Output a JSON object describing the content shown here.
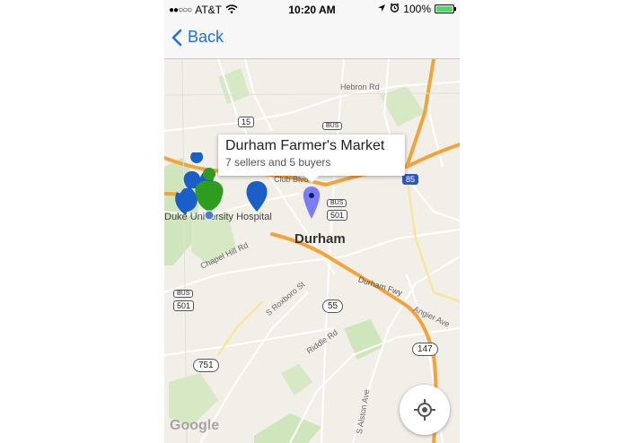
{
  "status_bar": {
    "carrier": "AT&T",
    "time": "10:20 AM",
    "battery": "100%"
  },
  "nav": {
    "back_label": "Back"
  },
  "map": {
    "labels": {
      "durham": "Durham",
      "hospital": "Duke University Hospital",
      "club_blvd": "Club Blvd",
      "hebron": "Hebron Rd",
      "chapel_hill": "Chapel Hill Rd",
      "roxboro": "S Roxboro St",
      "durham_fwy": "Durham Fwy",
      "angier": "Angier Ave",
      "riddle": "Riddle Rd",
      "alston": "S Alston Ave",
      "shield_15": "15",
      "shield_501": "501",
      "shield_501b": "501",
      "shield_55": "55",
      "shield_147": "147",
      "shield_751": "751",
      "shield_85": "85",
      "bus1": "BUS",
      "bus2": "BUS",
      "bus3": "BUS",
      "google": "Google"
    },
    "info_window": {
      "title": "Durham Farmer's Market",
      "subtitle": "7 sellers and 5 buyers"
    },
    "colors": {
      "seller_marker": "#1a5fc9",
      "buyer_marker": "#2e9d1f",
      "selected_marker": "#7b7cf7",
      "highway": "#f3a33a"
    }
  }
}
